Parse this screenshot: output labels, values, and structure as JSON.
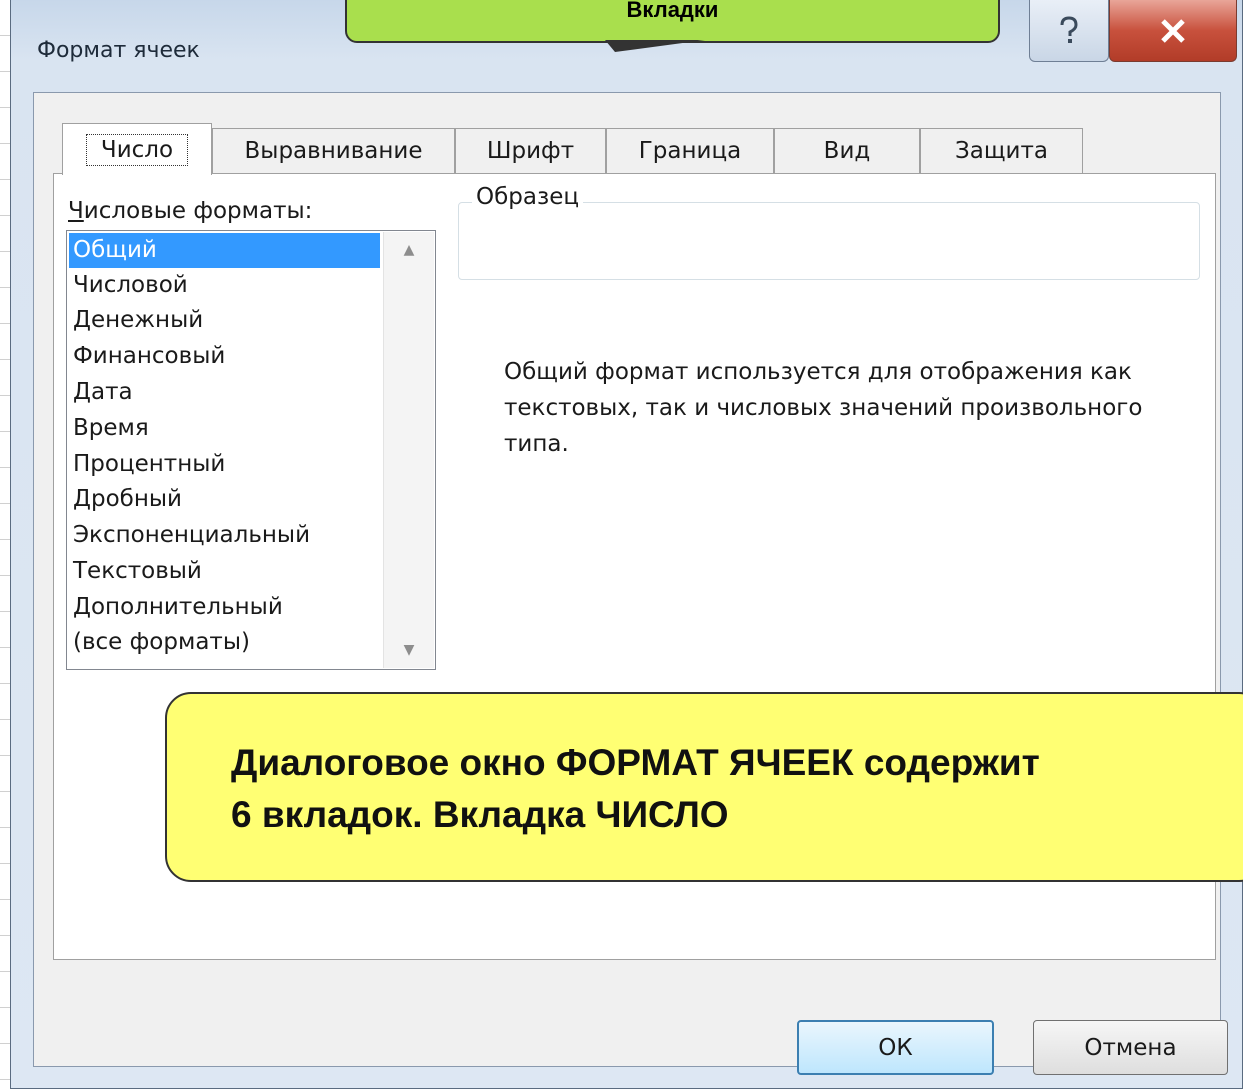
{
  "dialog": {
    "title": "Формат ячеек",
    "help_icon": "help-icon",
    "close_icon": "close-icon"
  },
  "tabs": [
    "Число",
    "Выравнивание",
    "Шрифт",
    "Граница",
    "Вид",
    "Защита"
  ],
  "active_tab": "Число",
  "number_formats": {
    "label_underlined": "Ч",
    "label_rest": "исловые форматы:",
    "items": [
      "Общий",
      "Числовой",
      "Денежный",
      "Финансовый",
      "Дата",
      "Время",
      "Процентный",
      "Дробный",
      "Экспоненциальный",
      "Текстовый",
      "Дополнительный",
      "(все форматы)"
    ],
    "selected": "Общий"
  },
  "sample": {
    "label": "Образец"
  },
  "description": "Общий формат используется для отображения как текстовых, так и числовых значений произвольного типа.",
  "buttons": {
    "ok": "ОК",
    "cancel": "Отмена"
  },
  "callouts": {
    "top": "Вкладки",
    "main_line1": "Диалоговое окно ФОРМАТ ЯЧЕЕК содержит",
    "main_line2": "6 вкладок. Вкладка ЧИСЛО"
  },
  "colors": {
    "selection": "#3399ff",
    "callout_green": "#a9df4d",
    "callout_yellow": "#ffff73"
  }
}
